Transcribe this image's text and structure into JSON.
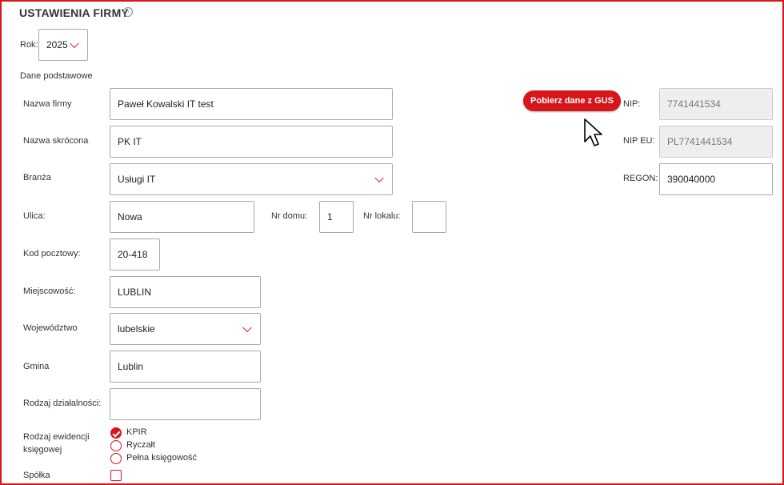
{
  "page": {
    "title": "USTAWIENIA FIRMY",
    "info_icon": "ⓘ"
  },
  "year": {
    "label": "Rok:",
    "value": "2025"
  },
  "section": {
    "heading": "Dane podstawowe"
  },
  "fields": {
    "nazwa_firmy": {
      "label": "Nazwa firmy",
      "value": "Paweł Kowalski IT test"
    },
    "nazwa_skrocona": {
      "label": "Nazwa skrócona",
      "value": "PK IT"
    },
    "branza": {
      "label": "Branża",
      "value": "Usługi IT"
    },
    "ulica": {
      "label": "Ulica:",
      "value": "Nowa"
    },
    "nr_domu": {
      "label": "Nr domu:",
      "value": "1"
    },
    "nr_lokalu": {
      "label": "Nr lokalu:",
      "value": ""
    },
    "kod_pocztowy": {
      "label": "Kod pocztowy:",
      "value": "20-418"
    },
    "miejscowosc": {
      "label": "Miejscowość:",
      "value": "LUBLIN"
    },
    "wojewodztwo": {
      "label": "Województwo",
      "value": "lubelskie"
    },
    "gmina": {
      "label": "Gmina",
      "value": "Lublin"
    },
    "rodzaj_dzialalnosci": {
      "label": "Rodzaj działalności:",
      "value": ""
    }
  },
  "gus_button": {
    "label": "Pobierz dane z GUS"
  },
  "right": {
    "nip": {
      "label": "NIP:",
      "value": "7741441534"
    },
    "nip_eu": {
      "label": "NIP EU:",
      "value": "PL7741441534"
    },
    "regon": {
      "label": "REGON:",
      "value": "390040000"
    }
  },
  "ewidencja": {
    "label_line1": "Rodzaj ewidencji",
    "label_line2": "księgowej",
    "options": [
      {
        "label": "KPIR",
        "checked": true
      },
      {
        "label": "Ryczałt",
        "checked": false
      },
      {
        "label": "Pełna księgowość",
        "checked": false
      }
    ]
  },
  "spolka": {
    "label": "Spółka",
    "checked": false
  },
  "colors": {
    "accent": "#d5161b",
    "border": "#aaa",
    "disabled_bg": "#eee"
  },
  "icons": {
    "cursor": "mouse-pointer-icon",
    "dropdown": "chevron-down-icon",
    "info": "info-icon"
  }
}
